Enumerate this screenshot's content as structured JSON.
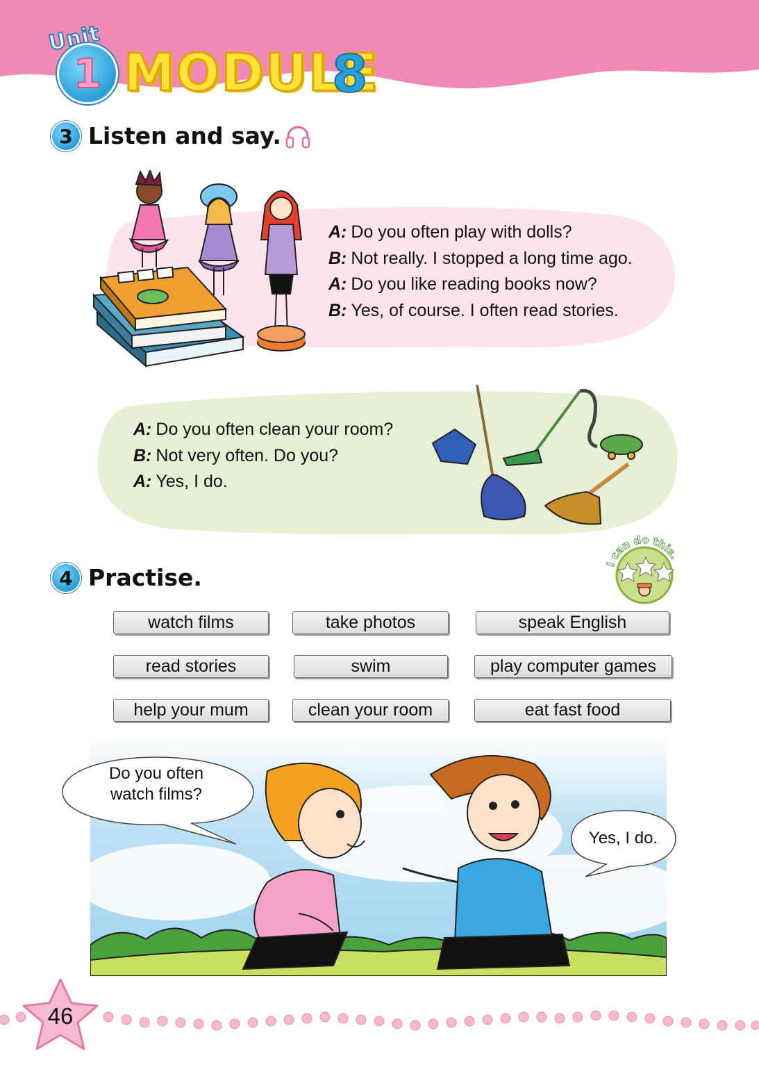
{
  "header": {
    "unit_word": "Unit",
    "unit_number": "1",
    "module_word": "MODULE",
    "module_number": "8"
  },
  "section3": {
    "number": "3",
    "title": "Listen and say.",
    "dialogue1": [
      {
        "speaker": "A:",
        "line": "Do you often play with dolls?"
      },
      {
        "speaker": "B:",
        "line": "Not really. I stopped a long time ago."
      },
      {
        "speaker": "A:",
        "line": "Do you like reading books now?"
      },
      {
        "speaker": "B:",
        "line": "Yes, of course. I often read stories."
      }
    ],
    "dialogue2": [
      {
        "speaker": "A:",
        "line": "Do you often clean your room?"
      },
      {
        "speaker": "B:",
        "line": "Not very often. Do you?"
      },
      {
        "speaker": "A:",
        "line": "Yes, I do."
      }
    ]
  },
  "section4": {
    "number": "4",
    "title": "Practise.",
    "badge_text": "I can do this.",
    "phrases": [
      "watch films",
      "take photos",
      "speak English",
      "read stories",
      "swim",
      "play computer games",
      "help your mum",
      "clean your room",
      "eat fast food"
    ],
    "bubble_left": [
      "Do you often",
      "watch films?"
    ],
    "bubble_right": "Yes, I do."
  },
  "footer": {
    "page_number": "46"
  },
  "colors": {
    "header_pink": "#f08ab4",
    "panel_pink": "#fce3ee",
    "panel_green": "#e6f0d4",
    "accent_blue": "#2b9fd8"
  }
}
